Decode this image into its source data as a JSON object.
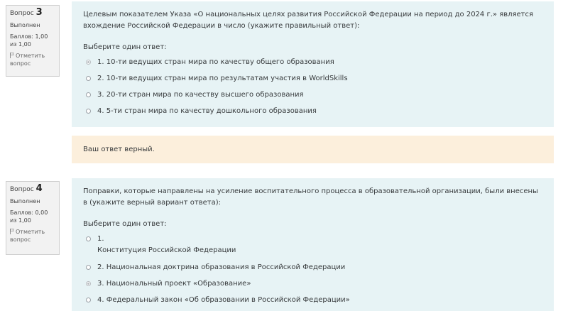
{
  "q3": {
    "info": {
      "qlabel": "Вопрос",
      "qnum": "3",
      "state": "Выполнен",
      "grade": "Баллов: 1,00 из 1,00",
      "flag_label": "Отметить вопрос"
    },
    "text": "Целевым показателем Указа «О национальных целях развития Российской Федерации на период до 2024 г.» является вхождение Российской Федерации в число (укажите правильный ответ):",
    "prompt": "Выберите один ответ:",
    "options": [
      "1. 10-ти ведущих стран мира по качеству общего образования",
      "2. 10-ти ведущих стран мира по результатам участия в WorldSkills",
      "3. 20-ти стран мира по качеству высшего образования",
      "4. 5-ти стран мира по качеству дошкольного образования"
    ],
    "selected_index": 0,
    "feedback": "Ваш ответ верный."
  },
  "q4": {
    "info": {
      "qlabel": "Вопрос",
      "qnum": "4",
      "state": "Выполнен",
      "grade": "Баллов: 0,00 из 1,00",
      "flag_label": "Отметить вопрос"
    },
    "text": "Поправки, которые направлены на усиление воспитательного процесса в образовательной организации, были внесены в (укажите верный вариант ответа):",
    "prompt": "Выберите один ответ:",
    "options": [
      "1.\nКонституция Российской Федерации",
      "2. Национальная доктрина образования в Российской Федерации",
      "3. Национальный проект «Образование»",
      "4. Федеральный закон «Об образовании в Российской Федерации»"
    ],
    "selected_index": 2
  }
}
